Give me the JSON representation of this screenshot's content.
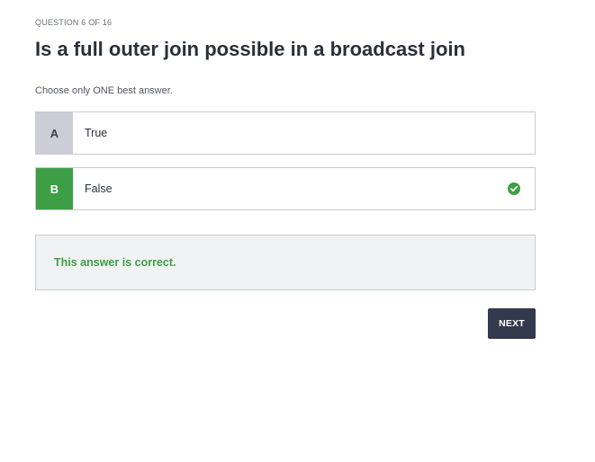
{
  "question": {
    "counter": "QUESTION 6 OF 16",
    "title": "Is a full outer join possible in a broadcast join",
    "instruction": "Choose only ONE best answer."
  },
  "answers": [
    {
      "letter": "A",
      "text": "True",
      "selected": false
    },
    {
      "letter": "B",
      "text": "False",
      "selected": true,
      "status_icon": "check-circle-icon"
    }
  ],
  "feedback": {
    "text": "This answer is correct."
  },
  "actions": {
    "next_label": "NEXT"
  },
  "colors": {
    "correct_green": "#3e9e46",
    "unselected_letter_bg": "#cccdd6",
    "button_bg": "#333a4e",
    "feedback_bg": "#f1f2f3"
  }
}
